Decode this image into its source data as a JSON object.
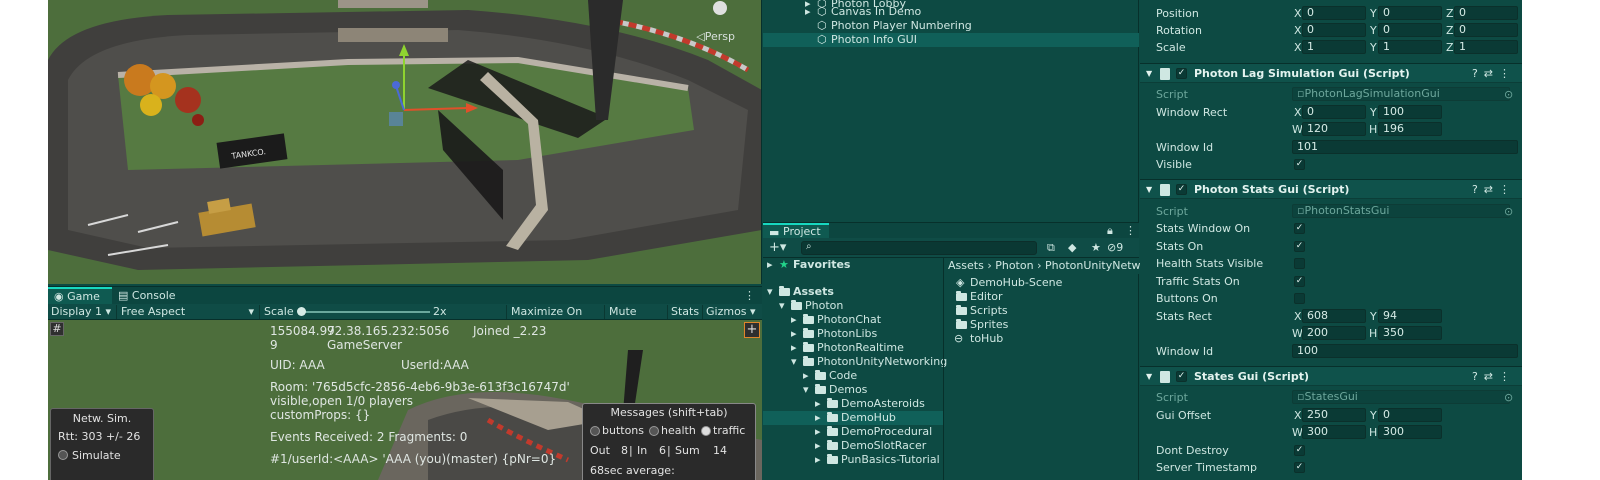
{
  "scene": {
    "persp_label": "◁Persp",
    "sign_text": "TANKCO."
  },
  "game": {
    "tabs": [
      {
        "label": "Game"
      },
      {
        "label": "Console"
      }
    ],
    "display": "Display 1",
    "aspect": "Free Aspect",
    "scale_label": "Scale",
    "scale_value": "2x",
    "maximize": "Maximize On Play",
    "mute": "Mute Audio",
    "stats": "Stats",
    "gizmos": "Gizmos",
    "hash_btn": "#",
    "plus_btn": "+",
    "info": {
      "line1a": "155084.97",
      "line1b": "92.38.165.232:5056",
      "line1c": "Joined _2.23",
      "line2a": "9",
      "line2b": "GameServer",
      "uid": "UID: AAA",
      "userid": "UserId:AAA",
      "room": "Room: '765d5cfc-2856-4eb6-9b3e-613f3c16747d'",
      "visible": "visible,open 1/0 players",
      "props": "customProps: {}",
      "events": "Events Received: 2 Fragments: 0",
      "player": "#1/userId:<AAA> 'AAA (you)(master) {pNr=0}"
    },
    "netw": {
      "title": "Netw. Sim.",
      "rtt": "Rtt: 303 +/- 26",
      "simulate": "Simulate"
    },
    "messages": {
      "title": "Messages (shift+tab)",
      "buttons": "buttons",
      "health": "health",
      "traffic": "traffic",
      "out": "Out",
      "out_val": "8",
      "in": "In",
      "in_val": "6",
      "sum": "Sum",
      "sum_val": "14",
      "cut": "68sec average:"
    }
  },
  "hierarchy": {
    "items": [
      {
        "label": "Photon Lobby"
      },
      {
        "label": "Canvas In Demo"
      },
      {
        "label": "Photon Player Numbering"
      },
      {
        "label": "Photon Info GUI"
      }
    ]
  },
  "project": {
    "tab": "Project",
    "favorites": "Favorites",
    "hidden_count": "9",
    "tree": [
      {
        "label": "Assets"
      },
      {
        "label": "Photon"
      },
      {
        "label": "PhotonChat"
      },
      {
        "label": "PhotonLibs"
      },
      {
        "label": "PhotonRealtime"
      },
      {
        "label": "PhotonUnityNetworking"
      },
      {
        "label": "Code"
      },
      {
        "label": "Demos"
      },
      {
        "label": "DemoAsteroids"
      },
      {
        "label": "DemoHub"
      },
      {
        "label": "DemoProcedural"
      },
      {
        "label": "DemoSlotRacer"
      },
      {
        "label": "PunBasics-Tutorial"
      }
    ],
    "breadcrumb": {
      "a": "Assets",
      "b": "Photon",
      "c": "PhotonUnityNetwo"
    },
    "assets": [
      {
        "label": "DemoHub-Scene"
      },
      {
        "label": "Editor"
      },
      {
        "label": "Scripts"
      },
      {
        "label": "Sprites"
      },
      {
        "label": "toHub"
      }
    ]
  },
  "inspector": {
    "transform": {
      "position": {
        "label": "Position",
        "x": "0",
        "y": "0",
        "z": "0"
      },
      "rotation": {
        "label": "Rotation",
        "x": "0",
        "y": "0",
        "z": "0"
      },
      "scale": {
        "label": "Scale",
        "x": "1",
        "y": "1",
        "z": "1"
      }
    },
    "lag": {
      "title": "Photon Lag Simulation Gui (Script)",
      "script_label": "Script",
      "script_value": "PhotonLagSimulationGui",
      "rect_label": "Window Rect",
      "x": "0",
      "y": "100",
      "w": "120",
      "h": "196",
      "id_label": "Window Id",
      "id_value": "101",
      "visible_label": "Visible"
    },
    "stats": {
      "title": "Photon Stats Gui (Script)",
      "script_label": "Script",
      "script_value": "PhotonStatsGui",
      "window_on": "Stats Window On",
      "stats_on": "Stats On",
      "health_visible": "Health Stats Visible",
      "traffic_on": "Traffic Stats On",
      "buttons_on": "Buttons On",
      "rect_label": "Stats Rect",
      "x": "608",
      "y": "94",
      "w": "200",
      "h": "350",
      "id_label": "Window Id",
      "id_value": "100"
    },
    "states": {
      "title": "States Gui (Script)",
      "script_label": "Script",
      "script_value": "StatesGui",
      "offset_label": "Gui Offset",
      "x": "250",
      "y": "0",
      "w": "300",
      "h": "300",
      "dont_destroy": "Dont Destroy",
      "server_ts": "Server Timestamp"
    },
    "axis": {
      "x": "X",
      "y": "Y",
      "z": "Z",
      "w": "W",
      "h": "H"
    }
  },
  "colors": {
    "accent": "#17d8c0",
    "panel": "#0d4a43",
    "grass": "#4b6b3a",
    "track": "#3c3b3a"
  }
}
